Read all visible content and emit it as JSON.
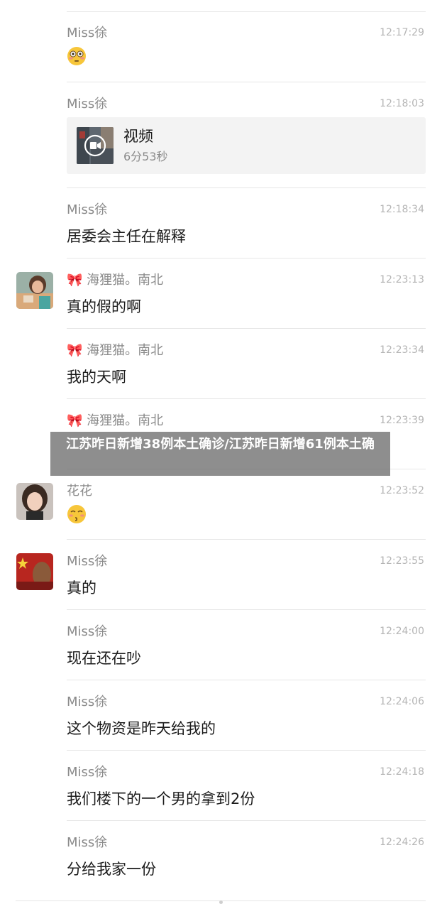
{
  "overlay_title": "江苏昨日新增38例本土确诊/江苏昨日新增61例本土确",
  "messages": [
    {
      "name": "Miss徐",
      "time": "12:17:29",
      "emoji": "flushed-face"
    },
    {
      "name": "Miss徐",
      "time": "12:18:03",
      "video": {
        "title": "视频",
        "duration": "6分53秒"
      }
    },
    {
      "name": "Miss徐",
      "time": "12:18:34",
      "text": "居委会主任在解释"
    },
    {
      "name": "海狸猫。南北",
      "time": "12:23:13",
      "text": "真的假的啊"
    },
    {
      "name": "海狸猫。南北",
      "time": "12:23:34",
      "text": "我的天啊"
    },
    {
      "name": "海狸猫。南北",
      "time": "12:23:39"
    },
    {
      "name": "花花",
      "time": "12:23:52",
      "emoji": "kissing-face"
    },
    {
      "name": "Miss徐",
      "time": "12:23:55",
      "text": "真的"
    },
    {
      "name": "Miss徐",
      "time": "12:24:00",
      "text": "现在还在吵"
    },
    {
      "name": "Miss徐",
      "time": "12:24:06",
      "text": "这个物资是昨天给我的"
    },
    {
      "name": "Miss徐",
      "time": "12:24:18",
      "text": "我们楼下的一个男的拿到2份"
    },
    {
      "name": "Miss徐",
      "time": "12:24:26",
      "text": "分给我家一份"
    }
  ]
}
